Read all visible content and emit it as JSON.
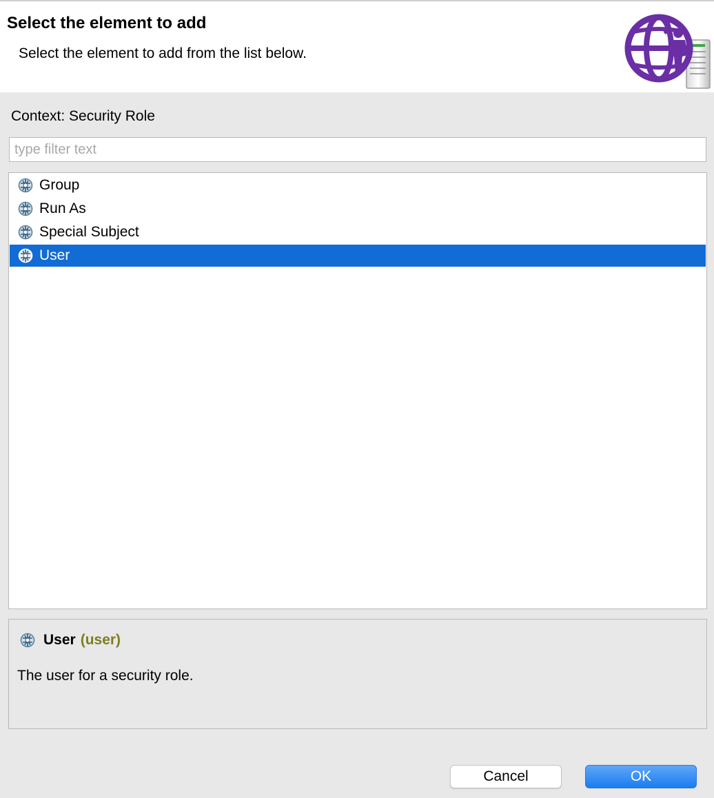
{
  "dialog": {
    "title": "Select the element to add",
    "description": "Select the element to add from the list below."
  },
  "context_label": "Context: Security Role",
  "filter": {
    "placeholder": "type filter text",
    "value": ""
  },
  "list": {
    "items": [
      {
        "label": "Group",
        "icon": "security-element-icon",
        "selected": false
      },
      {
        "label": "Run As",
        "icon": "security-element-icon",
        "selected": false
      },
      {
        "label": "Special Subject",
        "icon": "security-element-icon",
        "selected": false
      },
      {
        "label": "User",
        "icon": "security-element-icon",
        "selected": true
      }
    ]
  },
  "detail": {
    "name": "User",
    "id": "(user)",
    "description": "The user for a security role."
  },
  "buttons": {
    "cancel": "Cancel",
    "ok": "OK"
  },
  "colors": {
    "selection": "#116cd6",
    "accent_purple": "#6a2ea5",
    "id_text": "#7d7d22",
    "ok_button": "#1a7cf0"
  }
}
